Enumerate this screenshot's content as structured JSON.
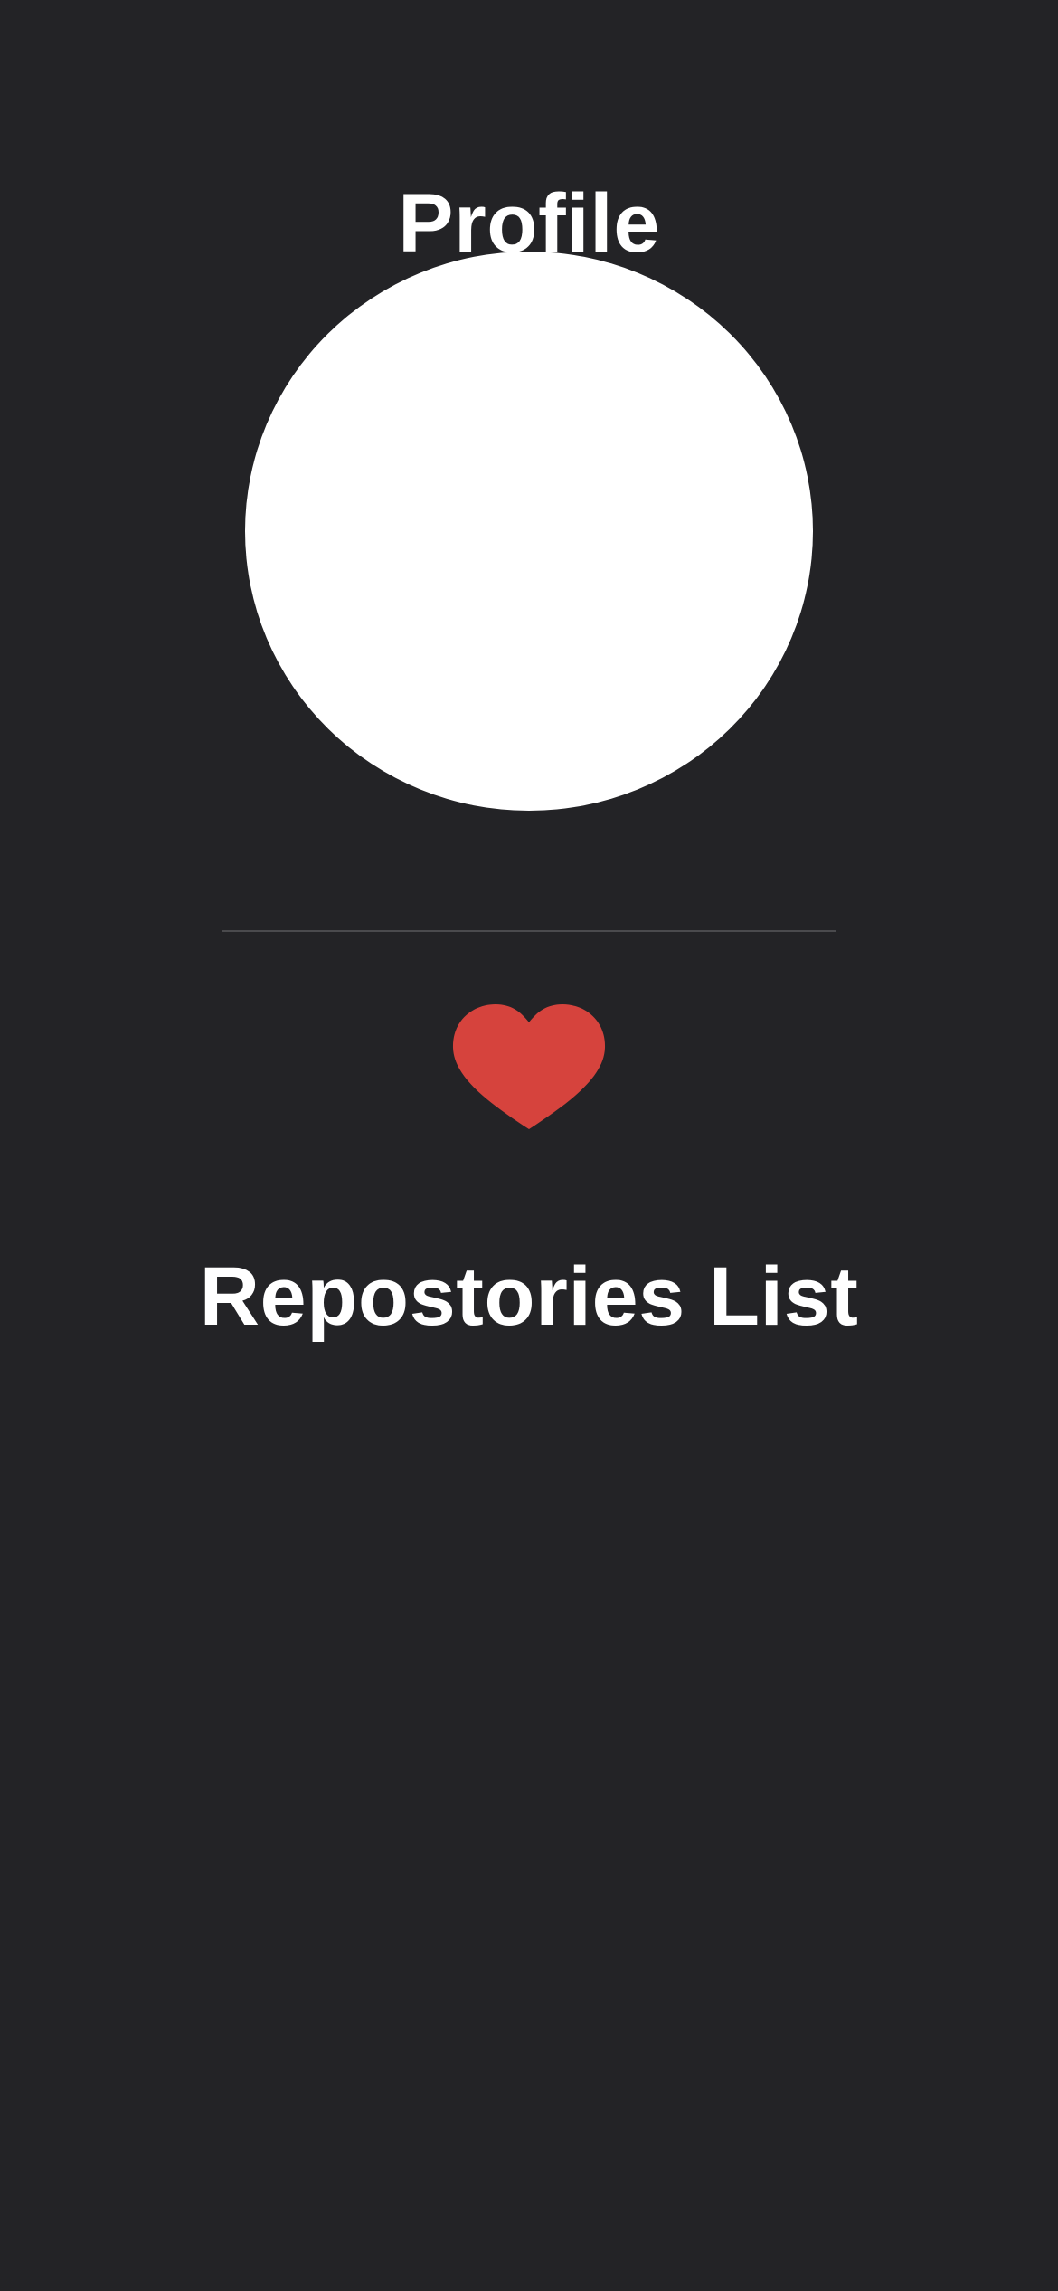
{
  "header": {
    "title": "Profile"
  },
  "profile": {
    "avatar_color": "#ffffff"
  },
  "favorite": {
    "icon": "heart-icon",
    "color": "#d6433d"
  },
  "repositories": {
    "title": "Repostories List",
    "items": []
  },
  "theme": {
    "background": "#232326",
    "text": "#ffffff",
    "divider": "#4a4a4d"
  }
}
